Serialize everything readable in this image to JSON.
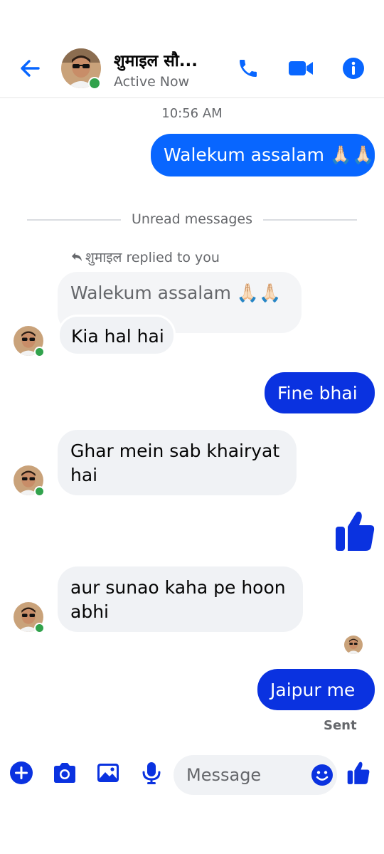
{
  "header": {
    "contact_name": "शुमाइल सौ...",
    "status": "Active Now"
  },
  "conversation": {
    "timestamp": "10:56 AM",
    "msg_out_1": "Walekum assalam 🙏🏻🙏🏻",
    "unread_label": "Unread messages",
    "reply_note": "शुमाइल replied to you",
    "quoted_text": "Walekum assalam 🙏🏻🙏🏻",
    "msg_in_1": "Kia hal hai",
    "msg_out_2": "Fine bhai",
    "msg_in_2": "Ghar mein sab khairyat hai",
    "msg_in_3": "aur sunao kaha pe hoon abhi",
    "msg_out_3": "Jaipur me",
    "sent_label": "Sent"
  },
  "composer": {
    "placeholder": "Message"
  },
  "colors": {
    "accent": "#0866ff",
    "accent_dark": "#0a32e0",
    "online": "#31a24c"
  },
  "icons": {
    "back": "arrow-left-icon",
    "call": "phone-icon",
    "video": "video-camera-icon",
    "info": "info-icon",
    "like": "thumbs-up-icon",
    "plus": "plus-icon",
    "camera": "camera-icon",
    "gallery": "image-icon",
    "mic": "microphone-icon",
    "emoji": "smiley-icon"
  }
}
